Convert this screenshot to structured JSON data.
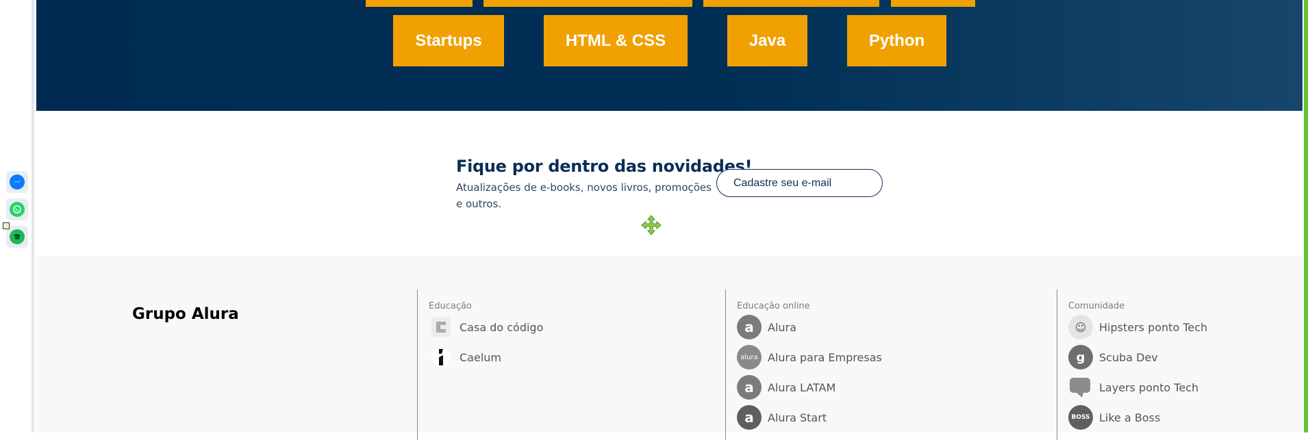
{
  "colors": {
    "hero_bg": "#002f55",
    "category_button": "#f0a000",
    "newsletter_heading": "#0b2e55",
    "footer_bg": "#f8f8f8",
    "right_edge": "#63c233"
  },
  "sidebar_icons": [
    {
      "name": "messenger-icon",
      "color": "#0a7cff"
    },
    {
      "name": "whatsapp-icon",
      "color": "#25d366"
    },
    {
      "name": "spotify-icon",
      "color": "#1db954"
    }
  ],
  "categories": [
    "Startups",
    "HTML & CSS",
    "Java",
    "Python"
  ],
  "newsletter": {
    "title": "Fique por dentro das novidades!",
    "description": "Atualizações de e-books, novos livros, promoções e outros.",
    "input_placeholder": "Cadastre seu e-mail"
  },
  "footer": {
    "brand": "Grupo Alura",
    "columns": [
      {
        "title": "Educação",
        "items": [
          {
            "label": "Casa do código",
            "icon": "casa-do-codigo-logo-icon"
          },
          {
            "label": "Caelum",
            "icon": "caelum-logo-icon"
          }
        ]
      },
      {
        "title": "Educação online",
        "items": [
          {
            "label": "Alura",
            "icon": "alura-logo-icon"
          },
          {
            "label": "Alura para Empresas",
            "icon": "alura-empresas-logo-icon"
          },
          {
            "label": "Alura LATAM",
            "icon": "alura-latam-logo-icon"
          },
          {
            "label": "Alura Start",
            "icon": "alura-start-logo-icon"
          }
        ]
      },
      {
        "title": "Comunidade",
        "items": [
          {
            "label": "Hipsters ponto Tech",
            "icon": "hipsters-logo-icon"
          },
          {
            "label": "Scuba Dev",
            "icon": "scuba-dev-logo-icon"
          },
          {
            "label": "Layers ponto Tech",
            "icon": "layers-logo-icon"
          },
          {
            "label": "Like a Boss",
            "icon": "like-a-boss-logo-icon"
          }
        ]
      }
    ]
  }
}
